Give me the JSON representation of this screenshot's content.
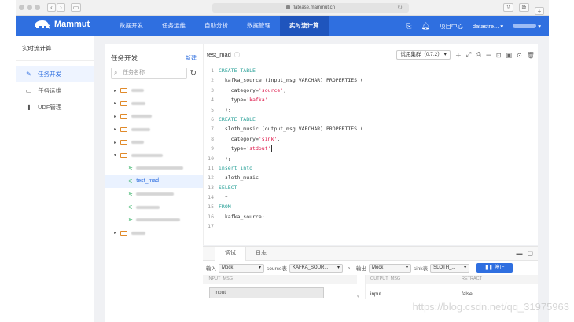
{
  "browser": {
    "url": "flatease.mammut.cn"
  },
  "app": {
    "brand": "Mammut",
    "nav": [
      "数据开发",
      "任务运维",
      "自助分析",
      "数据管理",
      "实时流计算"
    ],
    "active_nav": "实时流计算",
    "project_center": "项目中心",
    "org": "datastre..."
  },
  "sidebar": {
    "title": "实时流计算",
    "items": [
      {
        "label": "任务开发",
        "icon": "pencil-icon",
        "active": true
      },
      {
        "label": "任务运维",
        "icon": "monitor-icon",
        "active": false
      },
      {
        "label": "UDF管理",
        "icon": "document-icon",
        "active": false
      }
    ]
  },
  "tree": {
    "title": "任务开发",
    "new_label": "新建",
    "search_placeholder": "任务名称",
    "selected_task": "test_mad"
  },
  "editor": {
    "tab_title": "test_mad",
    "cluster": "试用集群（0.7.2）",
    "code": [
      [
        [
          "kw",
          "CREATE TABLE"
        ]
      ],
      [
        [
          "txt",
          "  kafka_source (input_msg VARCHAR) PROPERTIES ("
        ]
      ],
      [
        [
          "txt",
          "    category="
        ],
        [
          "str",
          "'source'"
        ],
        [
          "txt",
          ","
        ]
      ],
      [
        [
          "txt",
          "    type="
        ],
        [
          "str",
          "'kafka'"
        ]
      ],
      [
        [
          "txt",
          "  );"
        ]
      ],
      [
        [
          "kw",
          "CREATE TABLE"
        ]
      ],
      [
        [
          "txt",
          "  sloth_music (output_msg VARCHAR) PROPERTIES ("
        ]
      ],
      [
        [
          "txt",
          "    category="
        ],
        [
          "str",
          "'sink'"
        ],
        [
          "txt",
          ","
        ]
      ],
      [
        [
          "txt",
          "    type="
        ],
        [
          "str",
          "'stdout'"
        ]
      ],
      [
        [
          "txt",
          "  );"
        ]
      ],
      [
        [
          "kw",
          "insert into"
        ]
      ],
      [
        [
          "txt",
          "  sloth_music"
        ]
      ],
      [
        [
          "kw",
          "SELECT"
        ]
      ],
      [
        [
          "txt",
          "  *"
        ]
      ],
      [
        [
          "kw",
          "FROM"
        ]
      ],
      [
        [
          "txt",
          "  kafka_source;"
        ]
      ],
      [
        [
          "txt",
          ""
        ]
      ]
    ]
  },
  "debug": {
    "tabs": [
      "调试",
      "日志"
    ],
    "input_label": "输入",
    "input_mode": "Mock",
    "source_label": "source表",
    "source_value": "KAFKA_SOUR...",
    "output_label": "输出",
    "output_mode": "Mock",
    "sink_label": "sink表",
    "sink_value": "SLOTH_...",
    "stop_label": "停止",
    "input_col": "INPUT_MSG",
    "input_value": "input",
    "output_col": "OUTPUT_MSG",
    "retract_col": "RETRACT",
    "output_value": "input",
    "retract_value": "false"
  },
  "watermark": "https://blog.csdn.net/qq_31975963"
}
